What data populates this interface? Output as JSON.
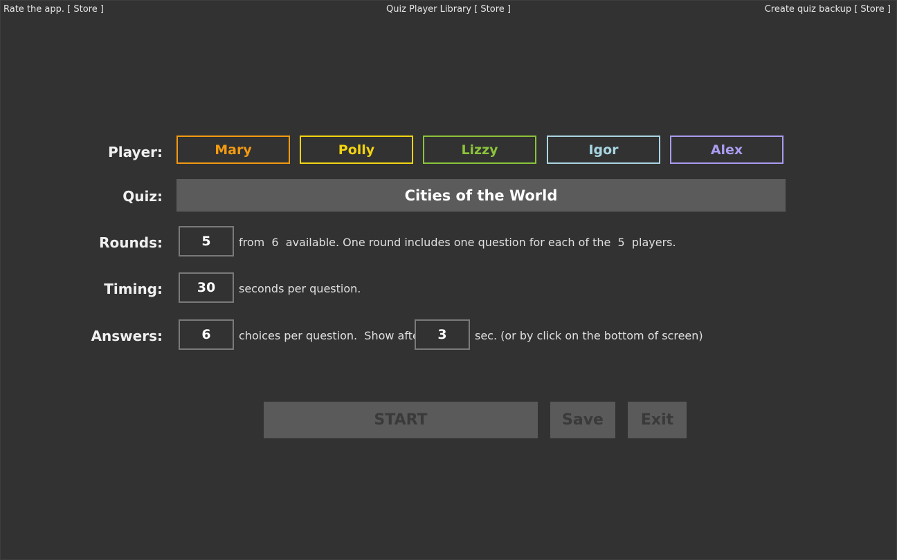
{
  "header": {
    "rate_app": "Rate the app. [ Store ]",
    "library": "Quiz Player Library [ Store ]",
    "backup": "Create quiz backup [ Store ]"
  },
  "labels": {
    "player": "Player:",
    "quiz": "Quiz:",
    "rounds": "Rounds:",
    "timing": "Timing:",
    "answers": "Answers:"
  },
  "players": [
    {
      "name": "Mary",
      "color": "#f39a12"
    },
    {
      "name": "Polly",
      "color": "#f2d411"
    },
    {
      "name": "Lizzy",
      "color": "#8bc43a"
    },
    {
      "name": "Igor",
      "color": "#a9d6e2"
    },
    {
      "name": "Alex",
      "color": "#a99cf0"
    }
  ],
  "quiz": {
    "title": "Cities of the World"
  },
  "rounds": {
    "value": "5",
    "text": "from  6  available. One round includes one question for each of the  5  players."
  },
  "timing": {
    "value": "30",
    "text": "seconds per question."
  },
  "answers": {
    "value": "6",
    "text": "choices per question.  Show after",
    "show_after_value": "3",
    "suffix": "sec. (or by click on the bottom of screen)"
  },
  "actions": {
    "start": "START",
    "save": "Save",
    "exit": "Exit"
  }
}
